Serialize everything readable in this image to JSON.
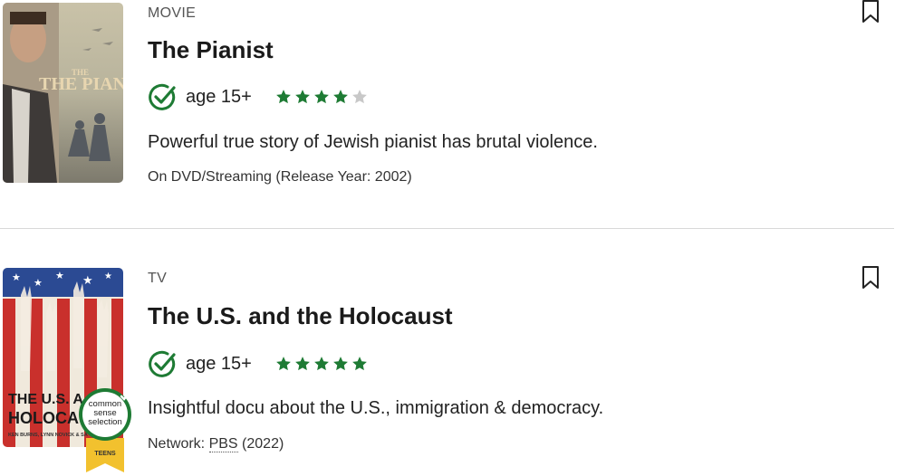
{
  "items": [
    {
      "type_label": "MOVIE",
      "title": "The Pianist",
      "poster_text": "THE PIANIST",
      "age": "age 15+",
      "stars_filled": 4,
      "stars_total": 5,
      "blurb": "Powerful true story of Jewish pianist has brutal violence.",
      "meta": "On DVD/Streaming (Release Year: 2002)"
    },
    {
      "type_label": "TV",
      "title": "The U.S. and the Holocaust",
      "poster_text_1": "THE U.S. A",
      "poster_text_2": "HOLOCA",
      "poster_credits": "KEN BURNS, LYNN NOVICK & SA",
      "age": "age 15+",
      "stars_filled": 5,
      "stars_total": 5,
      "blurb": "Insightful docu about the U.S., immigration & democracy.",
      "meta_prefix": "Network: ",
      "network": "PBS",
      "meta_suffix": " (2022)",
      "badge_text": "common sense selection",
      "badge_tier": "TEENS"
    }
  ],
  "colors": {
    "accent_green": "#1e7b34",
    "star_empty": "#c8c8c8",
    "badge_yellow": "#f2c12e"
  },
  "icons": {
    "check": "check-circle-icon",
    "star": "star-icon",
    "bookmark": "bookmark-icon"
  }
}
